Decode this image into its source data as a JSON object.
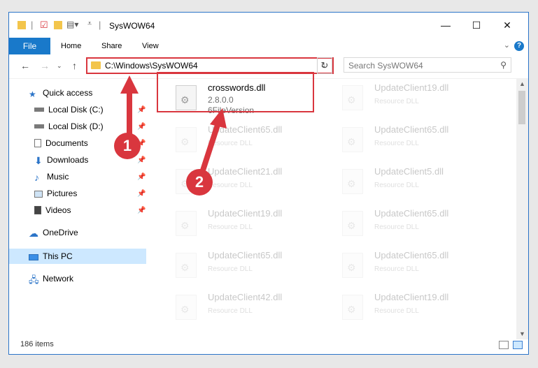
{
  "window": {
    "title": "SysWOW64",
    "controls": {
      "minimize": "—",
      "maximize": "☐",
      "close": "✕"
    }
  },
  "ribbon": {
    "tabs": [
      "File",
      "Home",
      "Share",
      "View"
    ],
    "expand": "⌄",
    "help": "?"
  },
  "address": {
    "path": "C:\\Windows\\SysWOW64",
    "search_placeholder": "Search SysWOW64"
  },
  "sidebar": {
    "items": [
      {
        "label": "Quick access",
        "icon": "star-icon",
        "pinned": false
      },
      {
        "label": "Local Disk (C:)",
        "icon": "drive-icon",
        "pinned": true
      },
      {
        "label": "Local Disk (D:)",
        "icon": "drive-icon",
        "pinned": true
      },
      {
        "label": "Documents",
        "icon": "documents-icon",
        "pinned": true
      },
      {
        "label": "Downloads",
        "icon": "downloads-icon",
        "pinned": true
      },
      {
        "label": "Music",
        "icon": "music-icon",
        "pinned": true
      },
      {
        "label": "Pictures",
        "icon": "pictures-icon",
        "pinned": true
      },
      {
        "label": "Videos",
        "icon": "videos-icon",
        "pinned": true
      },
      {
        "label": "OneDrive",
        "icon": "onedrive-icon",
        "pinned": false
      },
      {
        "label": "This PC",
        "icon": "pc-icon",
        "pinned": false,
        "selected": true
      },
      {
        "label": "Network",
        "icon": "network-icon",
        "pinned": false
      }
    ]
  },
  "files": {
    "selected": {
      "name": "crosswords.dll",
      "version": "2.8.0.0",
      "description": "6FileVersion"
    },
    "left_column": [
      {
        "name": "UpdateClient65.dll",
        "type": "Resource DLL"
      },
      {
        "name": "UpdateClient21.dll",
        "type": "Resource DLL"
      },
      {
        "name": "UpdateClient19.dll",
        "type": "Resource DLL"
      },
      {
        "name": "UpdateClient65.dll",
        "type": "Resource DLL"
      },
      {
        "name": "UpdateClient42.dll",
        "type": "Resource DLL"
      }
    ],
    "right_column": [
      {
        "name": "UpdateClient19.dll",
        "type": "Resource DLL"
      },
      {
        "name": "UpdateClient65.dll",
        "type": "Resource DLL"
      },
      {
        "name": "UpdateClient5.dll",
        "type": "Resource DLL"
      },
      {
        "name": "UpdateClient65.dll",
        "type": "Resource DLL"
      },
      {
        "name": "UpdateClient65.dll",
        "type": "Resource DLL"
      },
      {
        "name": "UpdateClient19.dll",
        "type": "Resource DLL"
      }
    ]
  },
  "status": {
    "item_count": "186 items"
  },
  "annotations": {
    "step1": "1",
    "step2": "2",
    "color": "#d9363e"
  }
}
